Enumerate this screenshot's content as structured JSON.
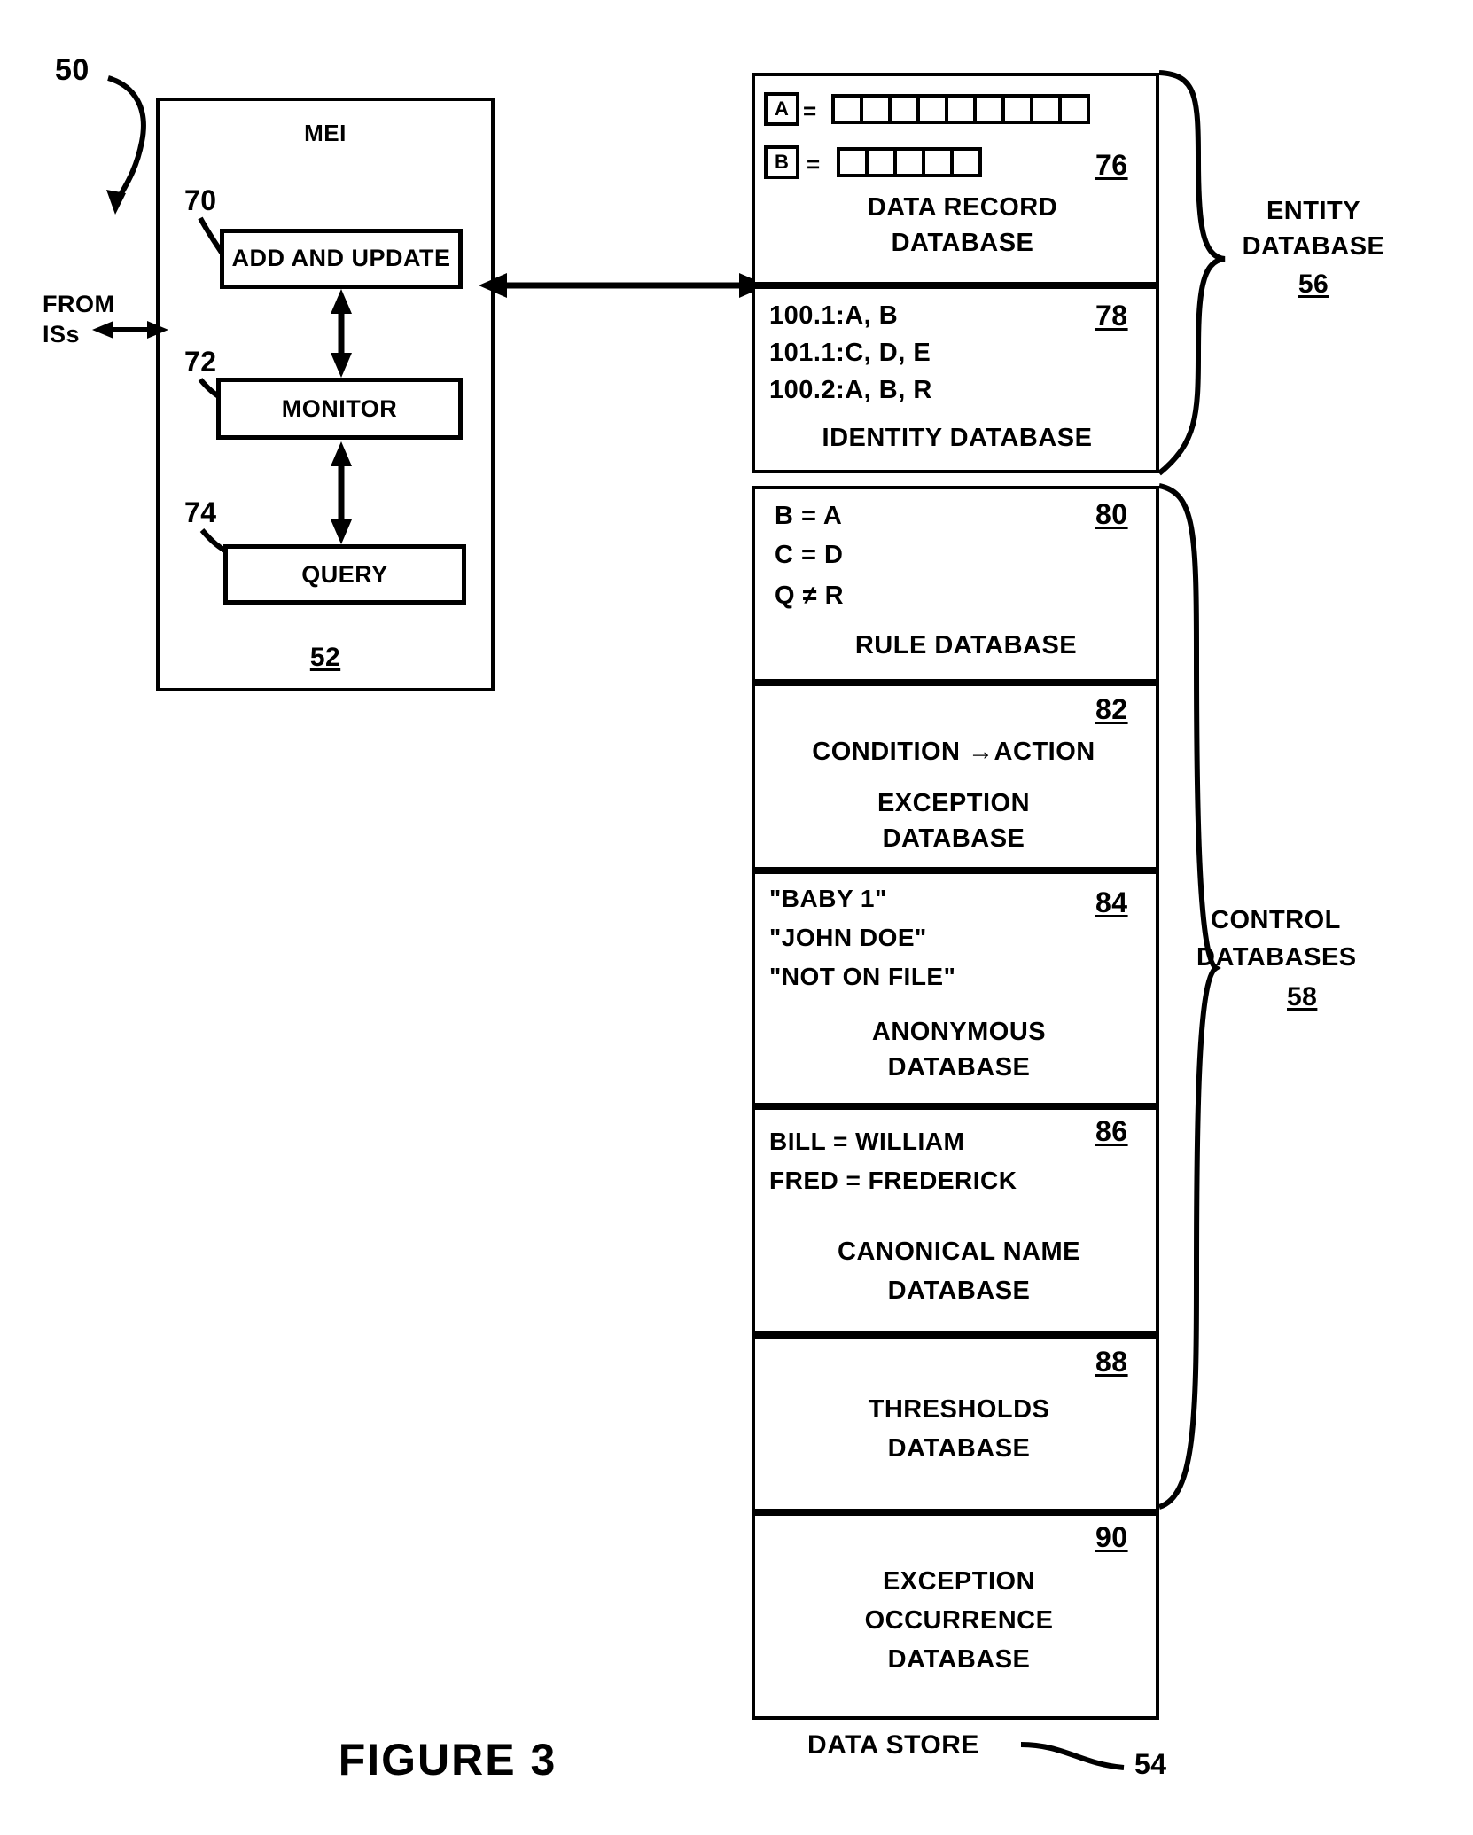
{
  "figure": {
    "caption": "FIGURE 3",
    "system_ref": "50"
  },
  "mei": {
    "title": "MEI",
    "ref": "52",
    "modules": [
      {
        "label": "ADD AND UPDATE",
        "ref": "70"
      },
      {
        "label": "MONITOR",
        "ref": "72"
      },
      {
        "label": "QUERY",
        "ref": "74"
      }
    ],
    "external": {
      "line1": "FROM",
      "line2": "ISs"
    }
  },
  "data_store": {
    "label": "DATA STORE",
    "ref": "54"
  },
  "groups": [
    {
      "name": "entity",
      "line1": "ENTITY",
      "line2": "DATABASE",
      "ref": "56"
    },
    {
      "name": "control",
      "line1": "CONTROL",
      "line2": "DATABASES",
      "ref": "58"
    }
  ],
  "databases": [
    {
      "id": "data-record",
      "ref": "76",
      "title_lines": [
        "DATA RECORD",
        "DATABASE"
      ],
      "records": [
        {
          "tag": "A",
          "eq": "=",
          "fields": 9
        },
        {
          "tag": "B",
          "eq": "=",
          "fields": 5
        }
      ]
    },
    {
      "id": "identity",
      "ref": "78",
      "entries": [
        "100.1:A, B",
        "101.1:C, D, E",
        "100.2:A, B, R"
      ],
      "title_lines": [
        "IDENTITY DATABASE"
      ]
    },
    {
      "id": "rule",
      "ref": "80",
      "entries": [
        "B = A",
        "C = D",
        "Q ≠ R"
      ],
      "title_lines": [
        "RULE  DATABASE"
      ]
    },
    {
      "id": "exception",
      "ref": "82",
      "entries": [
        "CONDITION →ACTION"
      ],
      "title_lines": [
        "EXCEPTION",
        "DATABASE"
      ]
    },
    {
      "id": "anonymous",
      "ref": "84",
      "entries": [
        "\"BABY 1\"",
        "\"JOHN DOE\"",
        "\"NOT ON FILE\""
      ],
      "title_lines": [
        "ANONYMOUS",
        "DATABASE"
      ]
    },
    {
      "id": "canonical-name",
      "ref": "86",
      "entries": [
        "BILL = WILLIAM",
        "FRED = FREDERICK"
      ],
      "title_lines": [
        "CANONICAL NAME",
        "DATABASE"
      ]
    },
    {
      "id": "thresholds",
      "ref": "88",
      "entries": [],
      "title_lines": [
        "THRESHOLDS",
        "DATABASE"
      ]
    },
    {
      "id": "exception-occurrence",
      "ref": "90",
      "entries": [],
      "title_lines": [
        "EXCEPTION",
        "OCCURRENCE",
        "DATABASE"
      ]
    }
  ]
}
